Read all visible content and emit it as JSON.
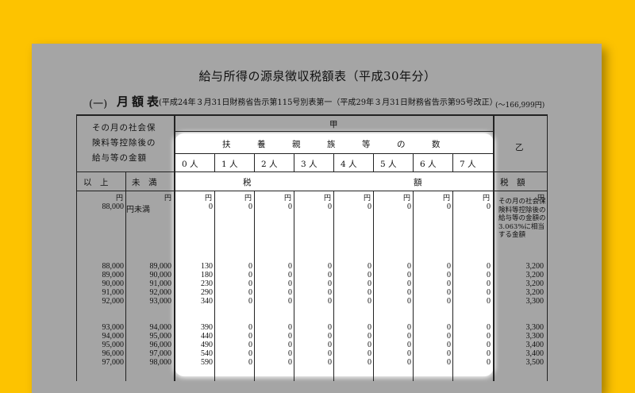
{
  "document": {
    "title": "給与所得の源泉徴収税額表（平成30年分）",
    "section_number": "(一)",
    "section_name": "月額表",
    "law_reference": "(平成24年３月31日財務省告示第115号別表第一（平成29年３月31日財務省告示第95号改正）",
    "range_note": "(～166,999円)"
  },
  "headers": {
    "amount_lines": [
      "その月の社会保",
      "険料等控除後の",
      "給与等の金額"
    ],
    "ko": "甲",
    "dependents": [
      "扶",
      "養",
      "親",
      "族",
      "等",
      "の",
      "数"
    ],
    "dependent_counts": [
      "0 人",
      "1 人",
      "2 人",
      "3 人",
      "4 人",
      "5 人",
      "6 人",
      "7 人"
    ],
    "otsu": "乙",
    "lower": "以　上",
    "upper": "未　満",
    "tax_left": "税",
    "tax_right": "額",
    "otsu_tax": "税　額",
    "yen": "円"
  },
  "first_row": {
    "lower": "88,000",
    "upper": "円未満",
    "values": [
      "0",
      "0",
      "0",
      "0",
      "0",
      "0",
      "0",
      "0"
    ],
    "otsu_note": "その月の社会保険料等控除後の給与等の金額の3.063%に相当する金額"
  },
  "rows": [
    {
      "lower": "88,000",
      "upper": "89,000",
      "values": [
        "130",
        "0",
        "0",
        "0",
        "0",
        "0",
        "0",
        "0"
      ],
      "otsu": "3,200"
    },
    {
      "lower": "89,000",
      "upper": "90,000",
      "values": [
        "180",
        "0",
        "0",
        "0",
        "0",
        "0",
        "0",
        "0"
      ],
      "otsu": "3,200"
    },
    {
      "lower": "90,000",
      "upper": "91,000",
      "values": [
        "230",
        "0",
        "0",
        "0",
        "0",
        "0",
        "0",
        "0"
      ],
      "otsu": "3,200"
    },
    {
      "lower": "91,000",
      "upper": "92,000",
      "values": [
        "290",
        "0",
        "0",
        "0",
        "0",
        "0",
        "0",
        "0"
      ],
      "otsu": "3,200"
    },
    {
      "lower": "92,000",
      "upper": "93,000",
      "values": [
        "340",
        "0",
        "0",
        "0",
        "0",
        "0",
        "0",
        "0"
      ],
      "otsu": "3,300"
    },
    {
      "lower": "93,000",
      "upper": "94,000",
      "values": [
        "390",
        "0",
        "0",
        "0",
        "0",
        "0",
        "0",
        "0"
      ],
      "otsu": "3,300"
    },
    {
      "lower": "94,000",
      "upper": "95,000",
      "values": [
        "440",
        "0",
        "0",
        "0",
        "0",
        "0",
        "0",
        "0"
      ],
      "otsu": "3,300"
    },
    {
      "lower": "95,000",
      "upper": "96,000",
      "values": [
        "490",
        "0",
        "0",
        "0",
        "0",
        "0",
        "0",
        "0"
      ],
      "otsu": "3,400"
    },
    {
      "lower": "96,000",
      "upper": "97,000",
      "values": [
        "540",
        "0",
        "0",
        "0",
        "0",
        "0",
        "0",
        "0"
      ],
      "otsu": "3,400"
    },
    {
      "lower": "97,000",
      "upper": "98,000",
      "values": [
        "590",
        "0",
        "0",
        "0",
        "0",
        "0",
        "0",
        "0"
      ],
      "otsu": "3,500"
    }
  ]
}
